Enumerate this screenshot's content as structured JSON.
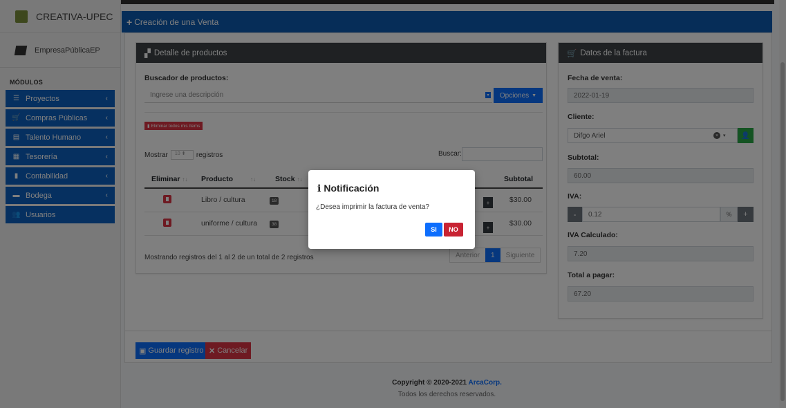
{
  "sidebar": {
    "brand": "CREATIVA-UPEC",
    "user": "EmpresaPúblicaEP",
    "section": "MÓDULOS",
    "items": [
      {
        "label": "Proyectos",
        "icon": "list-icon",
        "glyph": "☰",
        "chevron": "‹"
      },
      {
        "label": "Compras Públicas",
        "icon": "cart-icon",
        "glyph": "🛒",
        "chevron": "‹"
      },
      {
        "label": "Talento Humano",
        "icon": "id-card-icon",
        "glyph": "▤",
        "chevron": "‹"
      },
      {
        "label": "Tesorería",
        "icon": "calendar-icon",
        "glyph": "▦",
        "chevron": "‹"
      },
      {
        "label": "Contabilidad",
        "icon": "book-icon",
        "glyph": "▮",
        "chevron": "‹"
      },
      {
        "label": "Bodega",
        "icon": "warehouse-icon",
        "glyph": "▬",
        "chevron": "‹"
      },
      {
        "label": "Usuarios",
        "icon": "users-icon",
        "glyph": "👥",
        "chevron": ""
      }
    ]
  },
  "header": {
    "icon": "+",
    "title": "Creación de una Venta"
  },
  "products": {
    "title": "Detalle de productos",
    "search_label": "Buscador de productos:",
    "search_placeholder": "Ingrese una descripción",
    "options_label": "Opciones",
    "delete_all_label": "Eliminar todos mis ítems",
    "show_prefix": "Mostrar",
    "show_value": "10",
    "show_suffix": "registros",
    "search_table_label": "Buscar:",
    "columns": [
      "Eliminar",
      "Producto",
      "Stock",
      "Subtotal"
    ],
    "rows": [
      {
        "producto": "Libro / cultura",
        "stock": "18",
        "subtotal": "$30.00"
      },
      {
        "producto": "uniforme / cultura",
        "stock": "38",
        "subtotal": "$30.00"
      }
    ],
    "info": "Mostrando registros del 1 al 2 de un total de 2 registros",
    "pager": {
      "prev": "Anterior",
      "page": "1",
      "next": "Siguiente"
    }
  },
  "invoice": {
    "title": "Datos de la factura",
    "fecha_label": "Fecha de venta:",
    "fecha_value": "2022-01-19",
    "cliente_label": "Cliente:",
    "cliente_value": "Difgo Ariel",
    "subtotal_label": "Subtotal:",
    "subtotal_value": "60.00",
    "iva_label": "IVA:",
    "iva_value": "0.12",
    "iva_unit": "%",
    "iva_calc_label": "IVA Calculado:",
    "iva_calc_value": "7.20",
    "total_label": "Total a pagar:",
    "total_value": "67.20"
  },
  "actions": {
    "save": "Guardar registro",
    "cancel": "Cancelar"
  },
  "footer": {
    "copyright_prefix": "Copyright © 2020-2021 ",
    "company": "ArcaCorp.",
    "rights": "Todos los derechos reservados."
  },
  "modal": {
    "title": "Notificación",
    "message": "¿Desea imprimir la factura de venta?",
    "yes": "SI",
    "no": "NO"
  }
}
